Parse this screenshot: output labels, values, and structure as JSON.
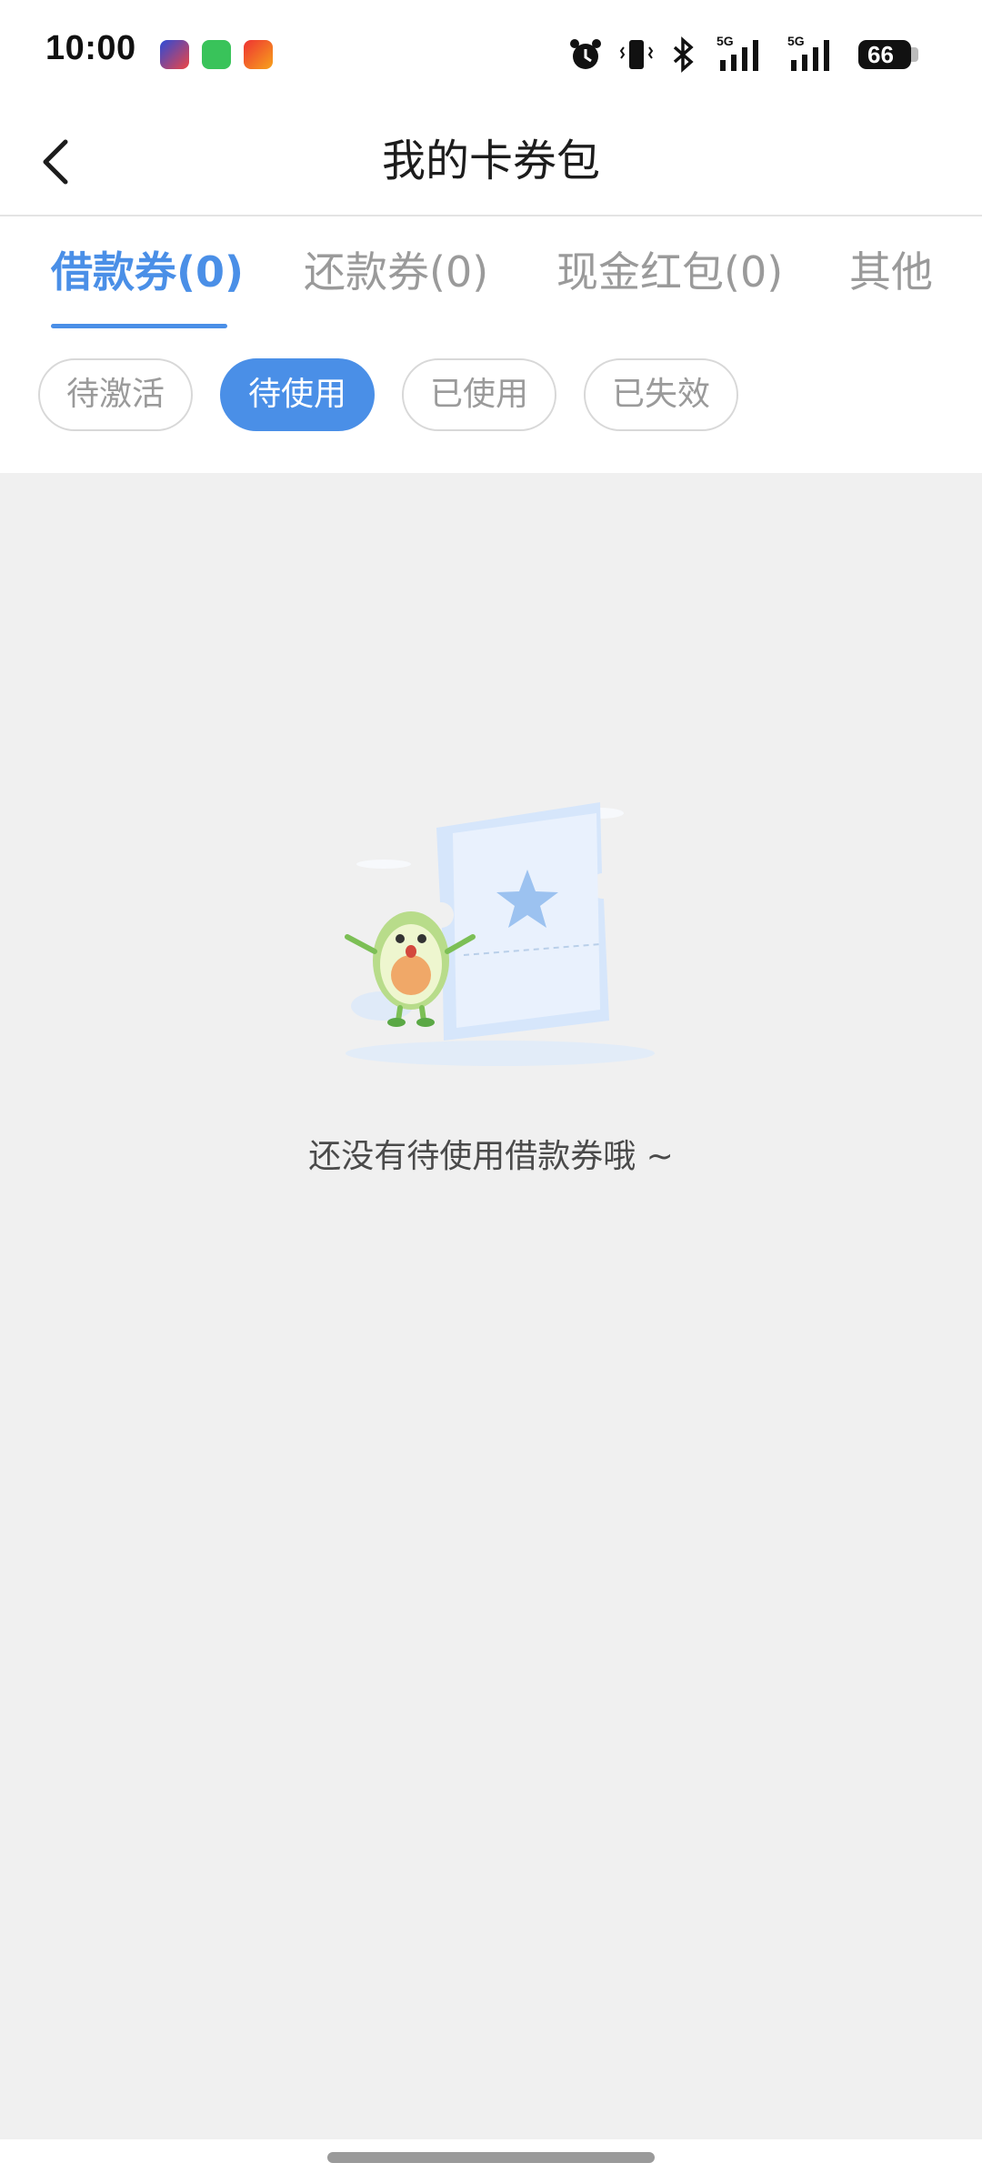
{
  "status_bar": {
    "time": "10:00",
    "battery": "66",
    "icons": [
      "alarm-icon",
      "vibrate-icon",
      "bluetooth-icon",
      "signal-5g-icon",
      "signal-5g-icon"
    ]
  },
  "header": {
    "title": "我的卡券包",
    "back_icon": "chevron-left-icon"
  },
  "tabs": [
    {
      "label": "借款券(0)",
      "active": true
    },
    {
      "label": "还款券(0)",
      "active": false
    },
    {
      "label": "现金红包(0)",
      "active": false
    },
    {
      "label": "其他",
      "active": false
    }
  ],
  "filters": [
    {
      "label": "待激活",
      "active": false
    },
    {
      "label": "待使用",
      "active": true
    },
    {
      "label": "已使用",
      "active": false
    },
    {
      "label": "已失效",
      "active": false
    }
  ],
  "empty_state": {
    "message": "还没有待使用借款券哦 ~",
    "illustration": "empty-coupon-illustration"
  },
  "colors": {
    "accent": "#4a8fe7",
    "background": "#f0f0f0"
  }
}
